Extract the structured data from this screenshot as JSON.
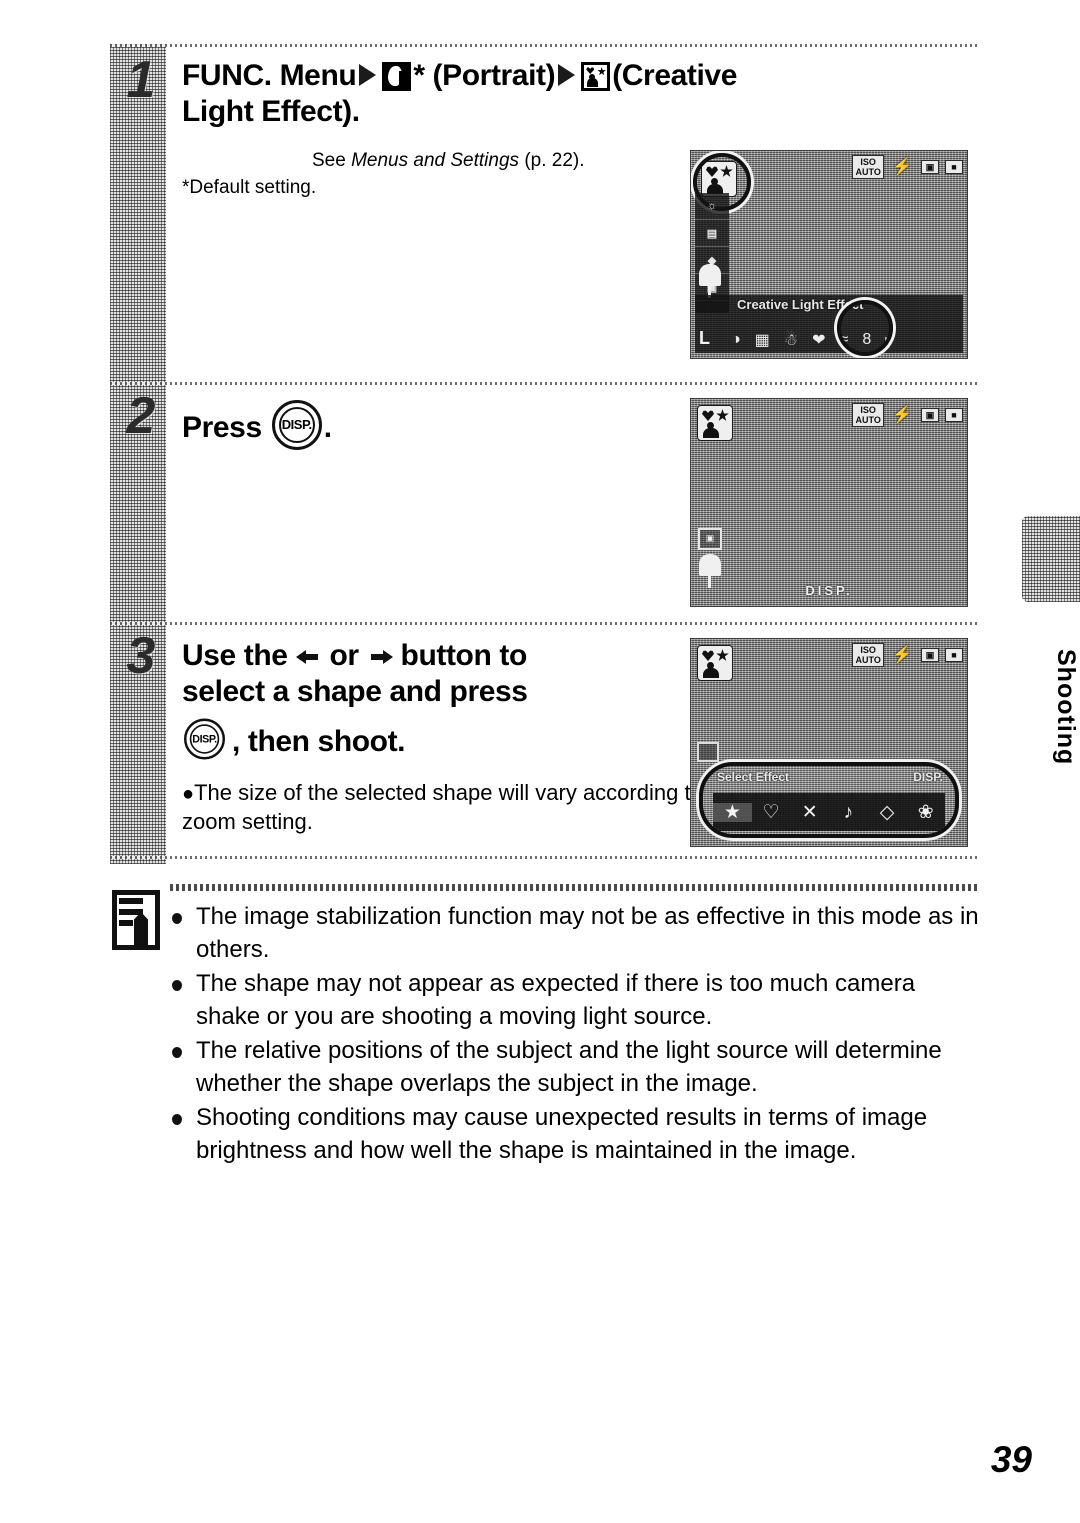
{
  "document": {
    "page_number": "39",
    "side_tab_label": "Shooting"
  },
  "steps": [
    {
      "number": "1",
      "heading_parts": {
        "func_menu": "FUNC. Menu",
        "portrait_label": "* (Portrait)",
        "creative_label": "(Creative",
        "heading_line2": "Light Effect)."
      },
      "see_text_prefix": "See ",
      "see_text_italic": "Menus and Settings",
      "see_text_suffix": " (p. 22).",
      "default_note": "*Default setting.",
      "icons": {
        "arrow1": "triangle-right-icon",
        "portrait": "portrait-mode-icon",
        "creative": "creative-light-effect-icon",
        "arrow2": "triangle-right-icon"
      }
    },
    {
      "number": "2",
      "heading_prefix": "Press",
      "button_label": "DISP.",
      "heading_suffix": "."
    },
    {
      "number": "3",
      "heading_line1_a": "Use the",
      "heading_line1_b": "or",
      "heading_line1_c": "button to",
      "heading_line2": "select a shape and press",
      "button_label": "DISP.",
      "heading_line3": ", then shoot.",
      "bullet": "The size of the selected shape will vary according to the zoom setting."
    }
  ],
  "lcd_screens": [
    {
      "name": "func-menu-screen",
      "status_icons": [
        "ISO AUTO",
        "flash-auto",
        "metering",
        "battery"
      ],
      "mode_badge": "creative-light-effect-icon",
      "left_column": [
        "",
        "",
        "",
        ""
      ],
      "menu_label": "Creative Light Effect",
      "quality_label": "L",
      "scene_icons": [
        "◐",
        "▦",
        "⛄",
        "❤",
        "≈",
        "8"
      ]
    },
    {
      "name": "shooting-screen",
      "status_icons": [
        "ISO AUTO",
        "flash-auto",
        "metering",
        "battery"
      ],
      "mode_badge": "creative-light-effect-icon",
      "disp_hint": "DISP."
    },
    {
      "name": "select-effect-screen",
      "status_icons": [
        "ISO AUTO",
        "flash-auto",
        "metering",
        "battery"
      ],
      "mode_badge": "creative-light-effect-icon",
      "panel_title": "Select Effect",
      "panel_hint": "DISP.",
      "effect_shapes": [
        "★",
        "♡",
        "✕",
        "♪",
        "◇",
        "❀"
      ]
    }
  ],
  "notes": [
    "The image stabilization function may not be as effective in this mode as in others.",
    "The shape may not appear as expected if there is too much camera shake or you are shooting a moving light source.",
    "The relative positions of the subject and the light source will determine whether the shape overlaps the subject in the image.",
    "Shooting conditions may cause unexpected results in terms of image brightness and how well the shape is maintained in the image."
  ],
  "colors": {
    "ink": "#000000",
    "paper": "#ffffff",
    "halftone": "#e2e2e2"
  }
}
